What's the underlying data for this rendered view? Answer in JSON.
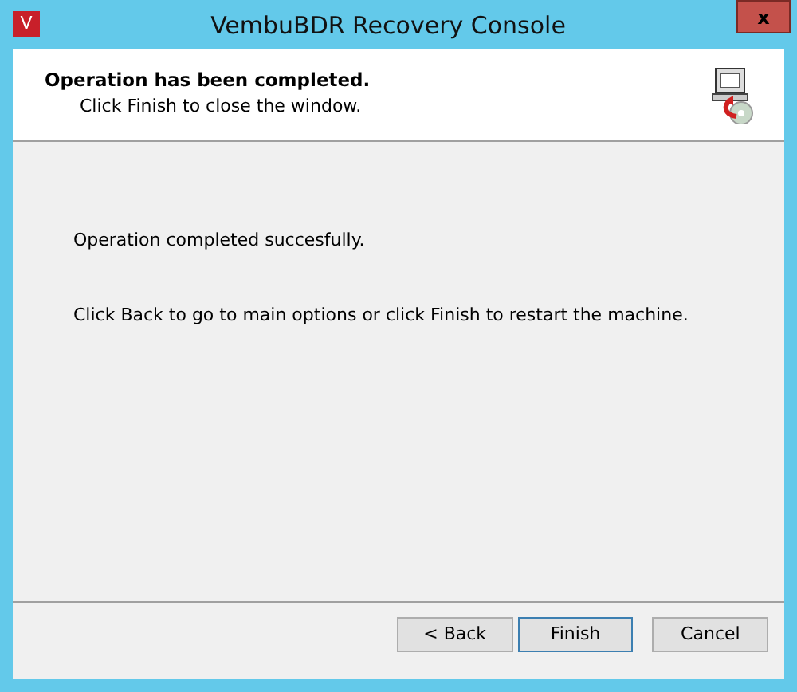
{
  "window": {
    "title": "VembuBDR Recovery Console",
    "app_icon": "V",
    "close": "x"
  },
  "header": {
    "title": "Operation has been completed.",
    "subtitle": "Click Finish to close the window."
  },
  "body": [
    "Operation completed succesfully.",
    "Click Back to go to main options or click Finish to restart the machine."
  ],
  "buttons": [
    {
      "label": "< Back",
      "focused": false
    },
    {
      "label": "Finish",
      "focused": true
    },
    {
      "label": "Cancel",
      "focused": false
    }
  ]
}
